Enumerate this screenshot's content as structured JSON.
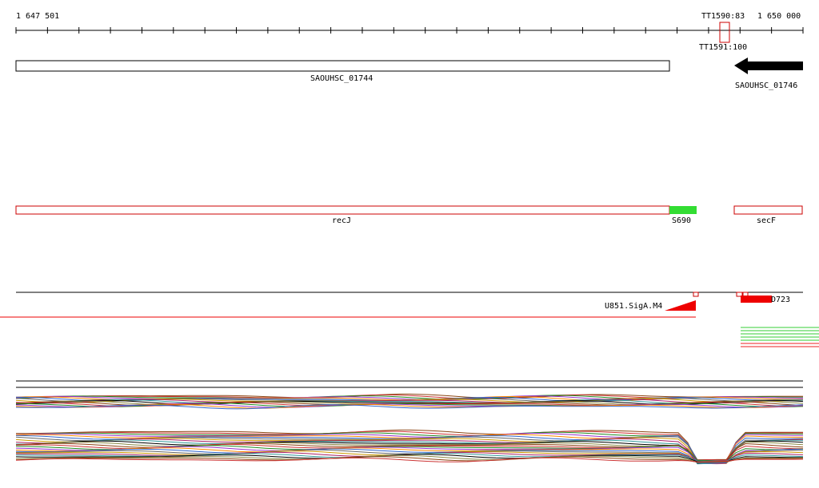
{
  "axis": {
    "start_label": "1 647 501",
    "end_label": "1 650 000",
    "tick_count": 26
  },
  "terminators": {
    "upper_label": "TT1590:83",
    "lower_label": "TT1591:100",
    "box_color": "#cc0000"
  },
  "genes": [
    {
      "label": "SAOUHSC_01744",
      "style": "outline",
      "color": "#000000"
    },
    {
      "label": "SAOUHSC_01746",
      "style": "arrow-left",
      "color": "#000000"
    }
  ],
  "annotations": [
    {
      "label": "recJ",
      "color": "#cc0000",
      "fill": "none"
    },
    {
      "label": "S690",
      "color": "#33dd33",
      "fill": "solid"
    },
    {
      "label": "secF",
      "color": "#cc0000",
      "fill": "none"
    }
  ],
  "promoters": [
    {
      "label": "U851.SigA.M4",
      "color": "#ee0000"
    },
    {
      "label": "D723",
      "color": "#ee0000"
    }
  ],
  "colors": {
    "axis": "#000000",
    "promoter": "#ee0000",
    "green_lines": "#33cc33",
    "red_lines": "#ee2222"
  },
  "expression_palette": [
    "#8b4513",
    "#cc3333",
    "#228b22",
    "#9933cc",
    "#ff8800",
    "#3366cc",
    "#666666",
    "#cc9900",
    "#aa2266",
    "#339999",
    "#000000",
    "#888844"
  ]
}
